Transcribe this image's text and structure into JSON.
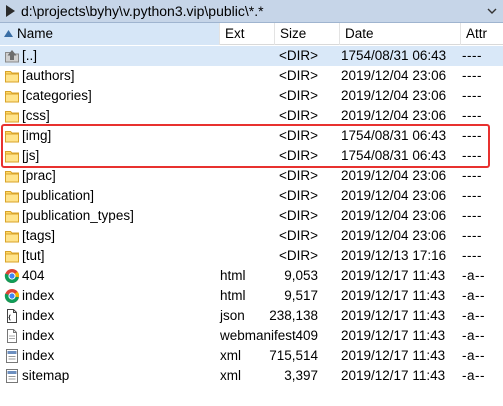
{
  "path_bar": {
    "path": "d:\\projects\\byhy\\v.python3.vip\\public\\*.*"
  },
  "columns": {
    "name": "Name",
    "ext": "Ext",
    "size": "Size",
    "date": "Date",
    "attr": "Attr"
  },
  "files": [
    {
      "icon": "up-folder-icon",
      "name": "[..]",
      "ext": "",
      "size": "<DIR>",
      "date": "1754/08/31 06:43",
      "attr": "----",
      "selected": true
    },
    {
      "icon": "folder-icon",
      "name": "[authors]",
      "ext": "",
      "size": "<DIR>",
      "date": "2019/12/04 23:06",
      "attr": "----"
    },
    {
      "icon": "folder-icon",
      "name": "[categories]",
      "ext": "",
      "size": "<DIR>",
      "date": "2019/12/04 23:06",
      "attr": "----"
    },
    {
      "icon": "folder-icon",
      "name": "[css]",
      "ext": "",
      "size": "<DIR>",
      "date": "2019/12/04 23:06",
      "attr": "----"
    },
    {
      "icon": "folder-icon",
      "name": "[img]",
      "ext": "",
      "size": "<DIR>",
      "date": "1754/08/31 06:43",
      "attr": "----"
    },
    {
      "icon": "folder-icon",
      "name": "[js]",
      "ext": "",
      "size": "<DIR>",
      "date": "1754/08/31 06:43",
      "attr": "----"
    },
    {
      "icon": "folder-icon",
      "name": "[prac]",
      "ext": "",
      "size": "<DIR>",
      "date": "2019/12/04 23:06",
      "attr": "----"
    },
    {
      "icon": "folder-icon",
      "name": "[publication]",
      "ext": "",
      "size": "<DIR>",
      "date": "2019/12/04 23:06",
      "attr": "----"
    },
    {
      "icon": "folder-icon",
      "name": "[publication_types]",
      "ext": "",
      "size": "<DIR>",
      "date": "2019/12/04 23:06",
      "attr": "----"
    },
    {
      "icon": "folder-icon",
      "name": "[tags]",
      "ext": "",
      "size": "<DIR>",
      "date": "2019/12/04 23:06",
      "attr": "----"
    },
    {
      "icon": "folder-icon",
      "name": "[tut]",
      "ext": "",
      "size": "<DIR>",
      "date": "2019/12/13 17:16",
      "attr": "----"
    },
    {
      "icon": "chrome-icon",
      "name": "404",
      "ext": "html",
      "size": "9,053",
      "date": "2019/12/17 11:43",
      "attr": "-a--"
    },
    {
      "icon": "chrome-icon",
      "name": "index",
      "ext": "html",
      "size": "9,517",
      "date": "2019/12/17 11:43",
      "attr": "-a--"
    },
    {
      "icon": "json-file-icon",
      "name": "index",
      "ext": "json",
      "size": "238,138",
      "date": "2019/12/17 11:43",
      "attr": "-a--"
    },
    {
      "icon": "generic-file-icon",
      "name": "index",
      "ext": "webmanifest",
      "size": "409",
      "date": "2019/12/17 11:43",
      "attr": "-a--"
    },
    {
      "icon": "xml-file-icon",
      "name": "index",
      "ext": "xml",
      "size": "715,514",
      "date": "2019/12/17 11:43",
      "attr": "-a--"
    },
    {
      "icon": "xml-file-icon",
      "name": "sitemap",
      "ext": "xml",
      "size": "3,397",
      "date": "2019/12/17 11:43",
      "attr": "-a--"
    }
  ],
  "colors": {
    "path_bar_bg": "#c6d5e8",
    "header_name_bg": "#d6e6f7",
    "selected_row_bg": "#d9e8f8",
    "highlight_border": "#e8312f",
    "folder_fill": "#ffd966"
  }
}
